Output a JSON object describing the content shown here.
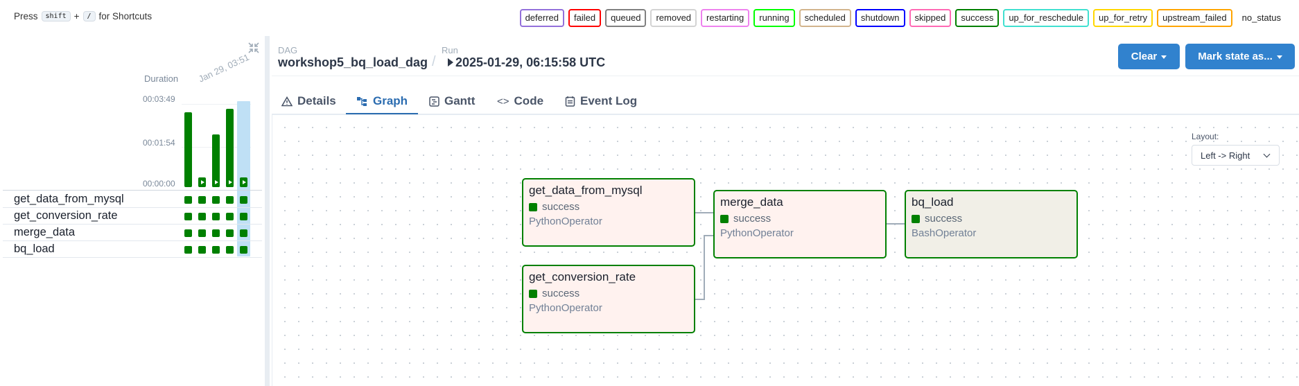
{
  "shortcuts": {
    "prefix": "Press",
    "key1": "shift",
    "plus": "+",
    "key2": "/",
    "suffix": "for Shortcuts"
  },
  "legend": [
    {
      "label": "deferred",
      "color": "#9370db"
    },
    {
      "label": "failed",
      "color": "#ff0000"
    },
    {
      "label": "queued",
      "color": "#808080"
    },
    {
      "label": "removed",
      "color": "#d3d3d3"
    },
    {
      "label": "restarting",
      "color": "#ee82ee"
    },
    {
      "label": "running",
      "color": "#00ff00"
    },
    {
      "label": "scheduled",
      "color": "#d2b48c"
    },
    {
      "label": "shutdown",
      "color": "#0000ff"
    },
    {
      "label": "skipped",
      "color": "#ff69b4"
    },
    {
      "label": "success",
      "color": "#008000"
    },
    {
      "label": "up_for_reschedule",
      "color": "#40e0d0"
    },
    {
      "label": "up_for_retry",
      "color": "#ffd700"
    },
    {
      "label": "upstream_failed",
      "color": "#ffa500"
    },
    {
      "label": "no_status",
      "color": ""
    }
  ],
  "grid": {
    "duration_label": "Duration",
    "date_label": "Jan 29, 03:51",
    "ticks": [
      "00:03:49",
      "00:01:54",
      "00:00:00"
    ],
    "runs": [
      {
        "duration_fraction": 0.88,
        "play": false
      },
      {
        "duration_fraction": 0.0,
        "play": true
      },
      {
        "duration_fraction": 0.62,
        "play": true
      },
      {
        "duration_fraction": 0.92,
        "play": true
      },
      {
        "duration_fraction": 0.0,
        "play": true
      }
    ],
    "tasks": [
      "get_data_from_mysql",
      "get_conversion_rate",
      "merge_data",
      "bq_load"
    ],
    "cell_color": "#008000"
  },
  "header": {
    "dag_label": "DAG",
    "dag_id": "workshop5_bq_load_dag",
    "sep": "/",
    "run_label": "Run",
    "run_id": "2025-01-29, 06:15:58 UTC",
    "clear_button": "Clear",
    "mark_state_button": "Mark state as..."
  },
  "tabs": [
    {
      "label": "Details",
      "icon": "warning-triangle-icon",
      "active": false
    },
    {
      "label": "Graph",
      "icon": "graph-icon",
      "active": true
    },
    {
      "label": "Gantt",
      "icon": "gantt-icon",
      "active": false
    },
    {
      "label": "Code",
      "icon": "code-icon",
      "active": false
    },
    {
      "label": "Event Log",
      "icon": "event-log-icon",
      "active": false
    }
  ],
  "graph": {
    "layout_label": "Layout:",
    "layout_value": "Left -> Right",
    "nodes": [
      {
        "title": "get_data_from_mysql",
        "state": "success",
        "operator": "PythonOperator"
      },
      {
        "title": "get_conversion_rate",
        "state": "success",
        "operator": "PythonOperator"
      },
      {
        "title": "merge_data",
        "state": "success",
        "operator": "PythonOperator"
      },
      {
        "title": "bq_load",
        "state": "success",
        "operator": "BashOperator"
      }
    ]
  }
}
